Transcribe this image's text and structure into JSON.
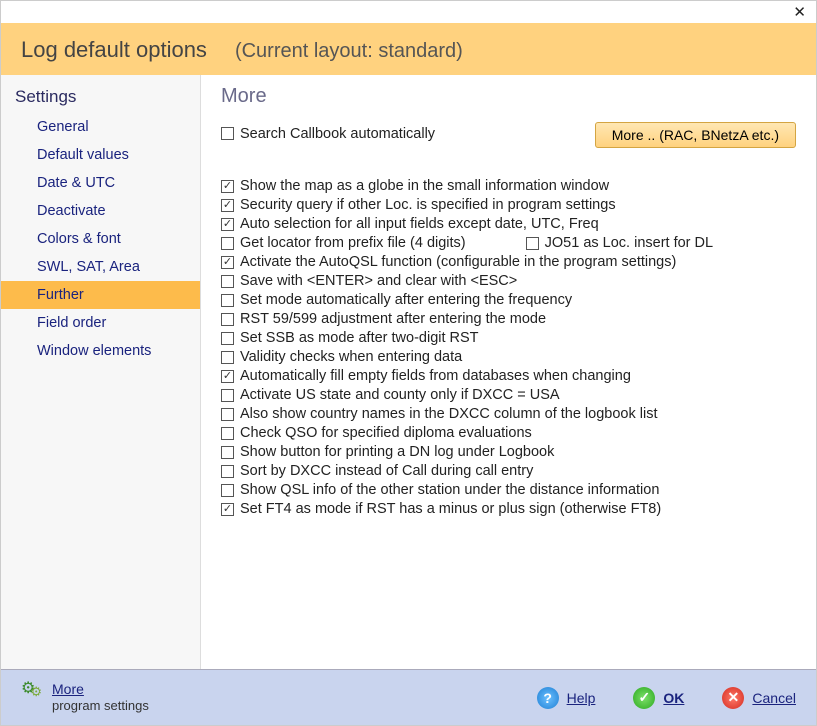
{
  "header": {
    "title": "Log default options",
    "subtitle": "(Current layout: standard)"
  },
  "sidebar": {
    "heading": "Settings",
    "items": [
      {
        "label": "General",
        "selected": false
      },
      {
        "label": "Default values",
        "selected": false
      },
      {
        "label": "Date & UTC",
        "selected": false
      },
      {
        "label": "Deactivate",
        "selected": false
      },
      {
        "label": "Colors & font",
        "selected": false
      },
      {
        "label": "SWL, SAT, Area",
        "selected": false
      },
      {
        "label": "Further",
        "selected": true
      },
      {
        "label": "Field order",
        "selected": false
      },
      {
        "label": "Window elements",
        "selected": false
      }
    ]
  },
  "main": {
    "section_title": "More",
    "top_checkbox": {
      "label": "Search Callbook automatically",
      "checked": false
    },
    "more_button": "More .. (RAC, BNetzA etc.)",
    "options": [
      {
        "label": "Show the map as a globe in the small information window",
        "checked": true
      },
      {
        "label": "Security query if other Loc. is specified in program settings",
        "checked": true
      },
      {
        "label": "Auto selection for all input fields except date, UTC, Freq",
        "checked": true
      },
      {
        "label": "Get locator from prefix file (4 digits)",
        "checked": false,
        "inline": {
          "label": "JO51 as Loc. insert for DL",
          "checked": false
        }
      },
      {
        "label": "Activate the AutoQSL function (configurable in the program settings)",
        "checked": true
      },
      {
        "label": "Save with <ENTER> and clear with <ESC>",
        "checked": false
      },
      {
        "label": "Set mode automatically after entering the frequency",
        "checked": false
      },
      {
        "label": "RST 59/599 adjustment after entering the mode",
        "checked": false
      },
      {
        "label": "Set SSB as mode after two-digit RST",
        "checked": false
      },
      {
        "label": "Validity checks when entering data",
        "checked": false
      },
      {
        "label": "Automatically fill empty fields from databases when changing",
        "checked": true
      },
      {
        "label": "Activate US state and county only if DXCC = USA",
        "checked": false
      },
      {
        "label": "Also show country names in the DXCC column of the logbook list",
        "checked": false
      },
      {
        "label": "Check QSO for specified diploma evaluations",
        "checked": false
      },
      {
        "label": "Show button for printing a DN log under Logbook",
        "checked": false
      },
      {
        "label": "Sort by DXCC instead of Call during call entry",
        "checked": false
      },
      {
        "label": "Show QSL info of the other station under the distance information",
        "checked": false
      },
      {
        "label": "Set FT4 as mode if RST has a minus or plus sign (otherwise FT8)",
        "checked": true
      }
    ]
  },
  "footer": {
    "more_label": "More",
    "more_sub": "program settings",
    "help": "Help",
    "ok": "OK",
    "cancel": "Cancel"
  }
}
